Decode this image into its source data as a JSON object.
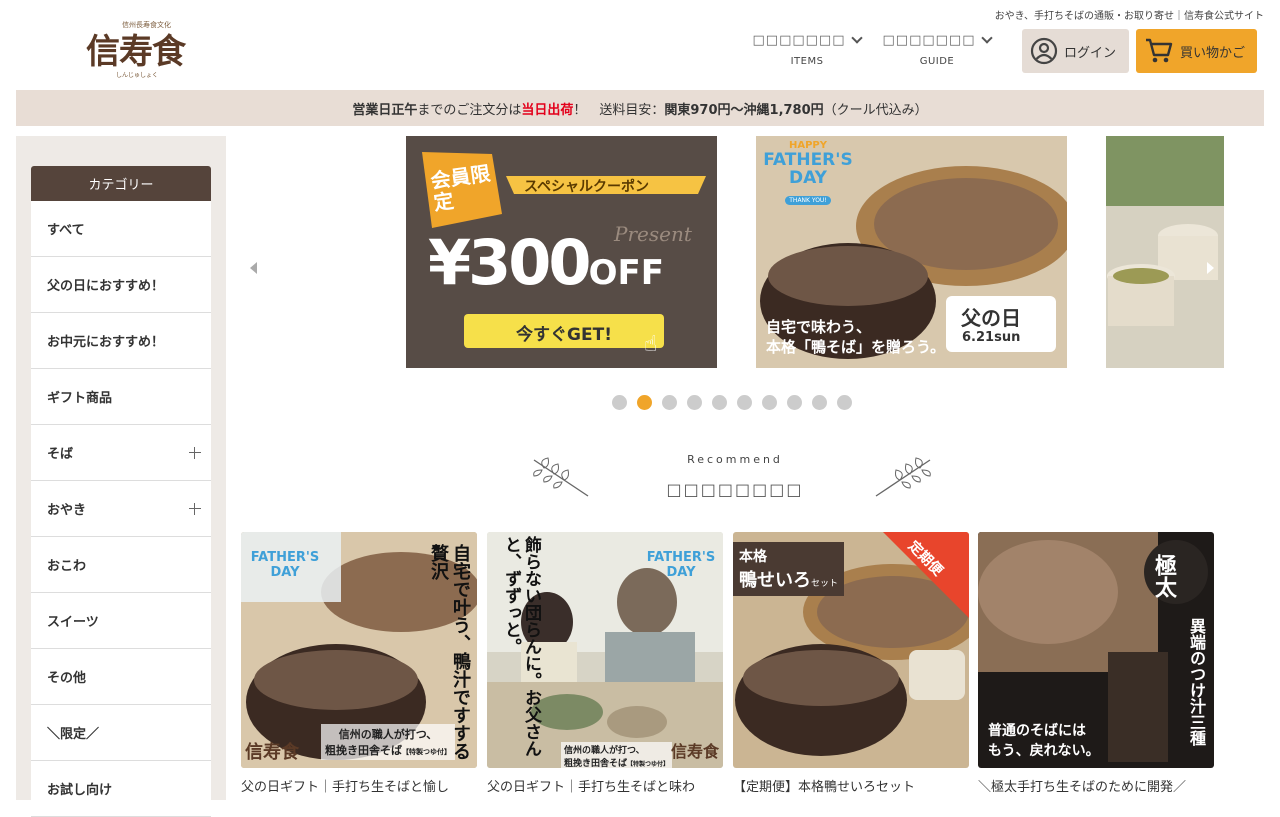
{
  "header": {
    "tagline": "おやき、手打ちそばの通販・お取り寄せ｜信寿食公式サイト",
    "logo_sub": "信州長寿食文化",
    "logo_text": "信寿食",
    "logo_ruby": "しんじゅしょく",
    "nav": [
      {
        "jp": "□□□□□□□",
        "en": "ITEMS"
      },
      {
        "jp": "□□□□□□□",
        "en": "GUIDE"
      }
    ],
    "login_label": "ログイン",
    "cart_label": "買い物かご"
  },
  "notice": {
    "part1": "営業日正午",
    "part2": "までのご注文分は",
    "part3": "当日出荷",
    "part4": "！　送料目安：",
    "part5": "関東970円〜沖縄1,780円",
    "part6": "（クール代込み）"
  },
  "sidebar": {
    "heading": "カテゴリー",
    "items": [
      {
        "label": "すべて",
        "expand": false
      },
      {
        "label": "父の日におすすめ！",
        "expand": false
      },
      {
        "label": "お中元におすすめ！",
        "expand": false
      },
      {
        "label": "ギフト商品",
        "expand": false
      },
      {
        "label": "そば",
        "expand": true
      },
      {
        "label": "おやき",
        "expand": true
      },
      {
        "label": "おこわ",
        "expand": false
      },
      {
        "label": "スイーツ",
        "expand": false
      },
      {
        "label": "その他",
        "expand": false
      },
      {
        "label": "＼限定／",
        "expand": false
      },
      {
        "label": "お試し向け",
        "expand": false
      }
    ]
  },
  "slider": {
    "slide1": {
      "badge": "会員限定",
      "ribbon": "スペシャルクーポン",
      "present": "Present",
      "amount": "¥300",
      "off": "OFF",
      "cta": "今すぐGET!"
    },
    "slide2": {
      "happy": "HAPPY",
      "fathers": "FATHER'S",
      "day": "DAY",
      "thanks": "THANK YOU!",
      "copy1": "自宅で味わう、",
      "copy2": "本格「鴨そば」を贈ろう。",
      "label": "父の日",
      "date": "6.21sun"
    },
    "dot_count": 10,
    "active_dot": 1
  },
  "recommend": {
    "en": "Recommend",
    "jp": "□□□□□□□□"
  },
  "products": [
    {
      "title": "父の日ギフト｜手打ち生そばと愉し",
      "img_text1": "自宅で叶う、",
      "img_text2": "鴨汁ですする贅沢",
      "img_caption1": "信州の職人が打つ、",
      "img_caption2": "粗挽き田舎そば",
      "img_caption3": "【特製つゆ付】",
      "logo": "信寿食"
    },
    {
      "title": "父の日ギフト｜手打ち生そばと味わ",
      "img_text1": "飾らない団らんに。",
      "img_text2": "お父さんと、ずずっと。",
      "img_caption1": "信州の職人が打つ、",
      "img_caption2": "粗挽き田舎そば",
      "img_caption3": "【特製つゆ付】",
      "logo": "信寿食"
    },
    {
      "title": "【定期便】本格鴨せいろセット",
      "img_text1": "本格",
      "img_text2": "鴨せいろ",
      "img_text3": "セット",
      "ribbon": "定期便"
    },
    {
      "title": "＼極太手打ち生そばのために開発／",
      "badge": "極太",
      "img_text1": "異端のつけ汁三種",
      "img_text2": "普通のそばには",
      "img_text3": "もう、戻れない。"
    }
  ]
}
